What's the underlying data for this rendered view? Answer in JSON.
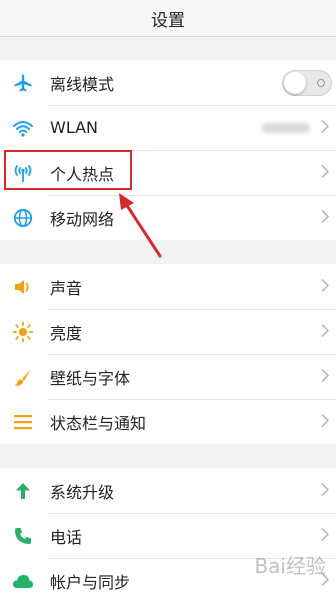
{
  "header": {
    "title": "设置"
  },
  "groups": [
    {
      "items": [
        {
          "label": "离线模式",
          "icon": "airplane-icon",
          "control": "toggle",
          "toggle_on": false
        },
        {
          "label": "WLAN",
          "icon": "wifi-icon",
          "control": "chevron"
        },
        {
          "label": "个人热点",
          "icon": "hotspot-icon",
          "control": "chevron",
          "highlighted": true
        },
        {
          "label": "移动网络",
          "icon": "globe-icon",
          "control": "chevron"
        }
      ]
    },
    {
      "items": [
        {
          "label": "声音",
          "icon": "speaker-icon",
          "control": "chevron"
        },
        {
          "label": "亮度",
          "icon": "brightness-icon",
          "control": "chevron"
        },
        {
          "label": "壁纸与字体",
          "icon": "brush-icon",
          "control": "chevron"
        },
        {
          "label": "状态栏与通知",
          "icon": "notification-list-icon",
          "control": "chevron"
        }
      ]
    },
    {
      "items": [
        {
          "label": "系统升级",
          "icon": "arrow-up-icon",
          "control": "chevron"
        },
        {
          "label": "电话",
          "icon": "phone-icon",
          "control": "chevron"
        },
        {
          "label": "帐户与同步",
          "icon": "cloud-icon",
          "control": "chevron"
        }
      ]
    }
  ],
  "colors": {
    "accent_blue": "#1aa0e8",
    "accent_orange": "#f5a011",
    "accent_green": "#26b06a",
    "annotation_red": "#d42b2b"
  },
  "watermark": "Bai经验"
}
